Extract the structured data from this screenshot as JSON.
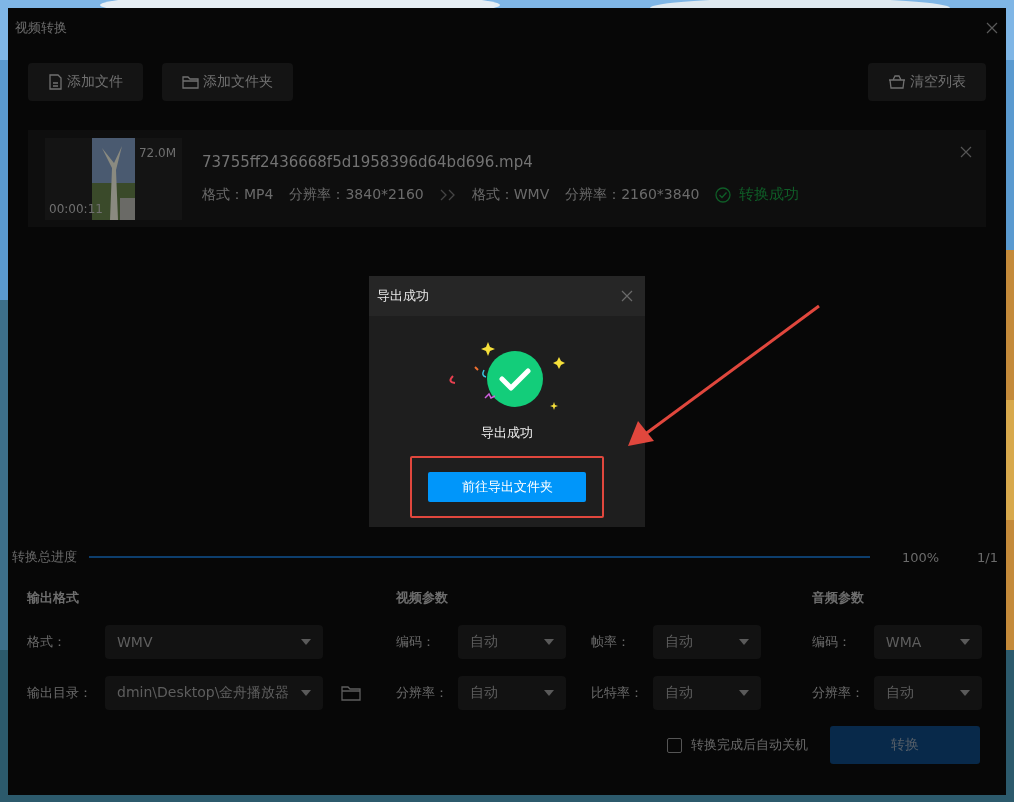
{
  "window": {
    "title": "视频转换"
  },
  "toolbar": {
    "buttons": [
      {
        "label": "添加文件",
        "kind": "file"
      },
      {
        "label": "添加文件夹",
        "kind": "folder"
      }
    ],
    "clear_button": {
      "label": "清空列表"
    }
  },
  "files": [
    {
      "name": "73755ff2436668f5d1958396d64bd696.mp4",
      "size": "72.0M",
      "duration": "00:00:11",
      "source": [
        "格式：MP4",
        "分辨率：3840*2160"
      ],
      "target": [
        "格式：WMV",
        "分辨率：2160*3840"
      ],
      "status": "转换成功"
    }
  ],
  "progress": {
    "label": "转换总进度",
    "level": 1,
    "percent": "100%",
    "count": "1/1"
  },
  "sections": [
    {
      "title": "输出格式",
      "kind": "output",
      "fields": [
        {
          "label": "格式：",
          "value": "WMV"
        },
        {
          "label": "输出目录：",
          "value": "dmin\\Desktop\\金舟播放器",
          "folder": true
        }
      ]
    },
    {
      "title": "视频参数",
      "kind": "grid",
      "fields": [
        {
          "label": "编码：",
          "value": "自动"
        },
        {
          "label": "帧率：",
          "value": "自动"
        },
        {
          "label": "分辨率：",
          "value": "自动"
        },
        {
          "label": "比特率：",
          "value": "自动"
        }
      ]
    },
    {
      "title": "音频参数",
      "kind": "audio",
      "fields": [
        {
          "label": "编码：",
          "value": "WMA"
        },
        {
          "label": "分辨率：",
          "value": "自动"
        }
      ]
    }
  ],
  "shutdown": {
    "label": "转换完成后自动关机",
    "checked": false
  },
  "convert_button": {
    "label": "转换"
  },
  "dialog": {
    "title": "导出成功",
    "message": "导出成功",
    "button": "前往导出文件夹"
  }
}
